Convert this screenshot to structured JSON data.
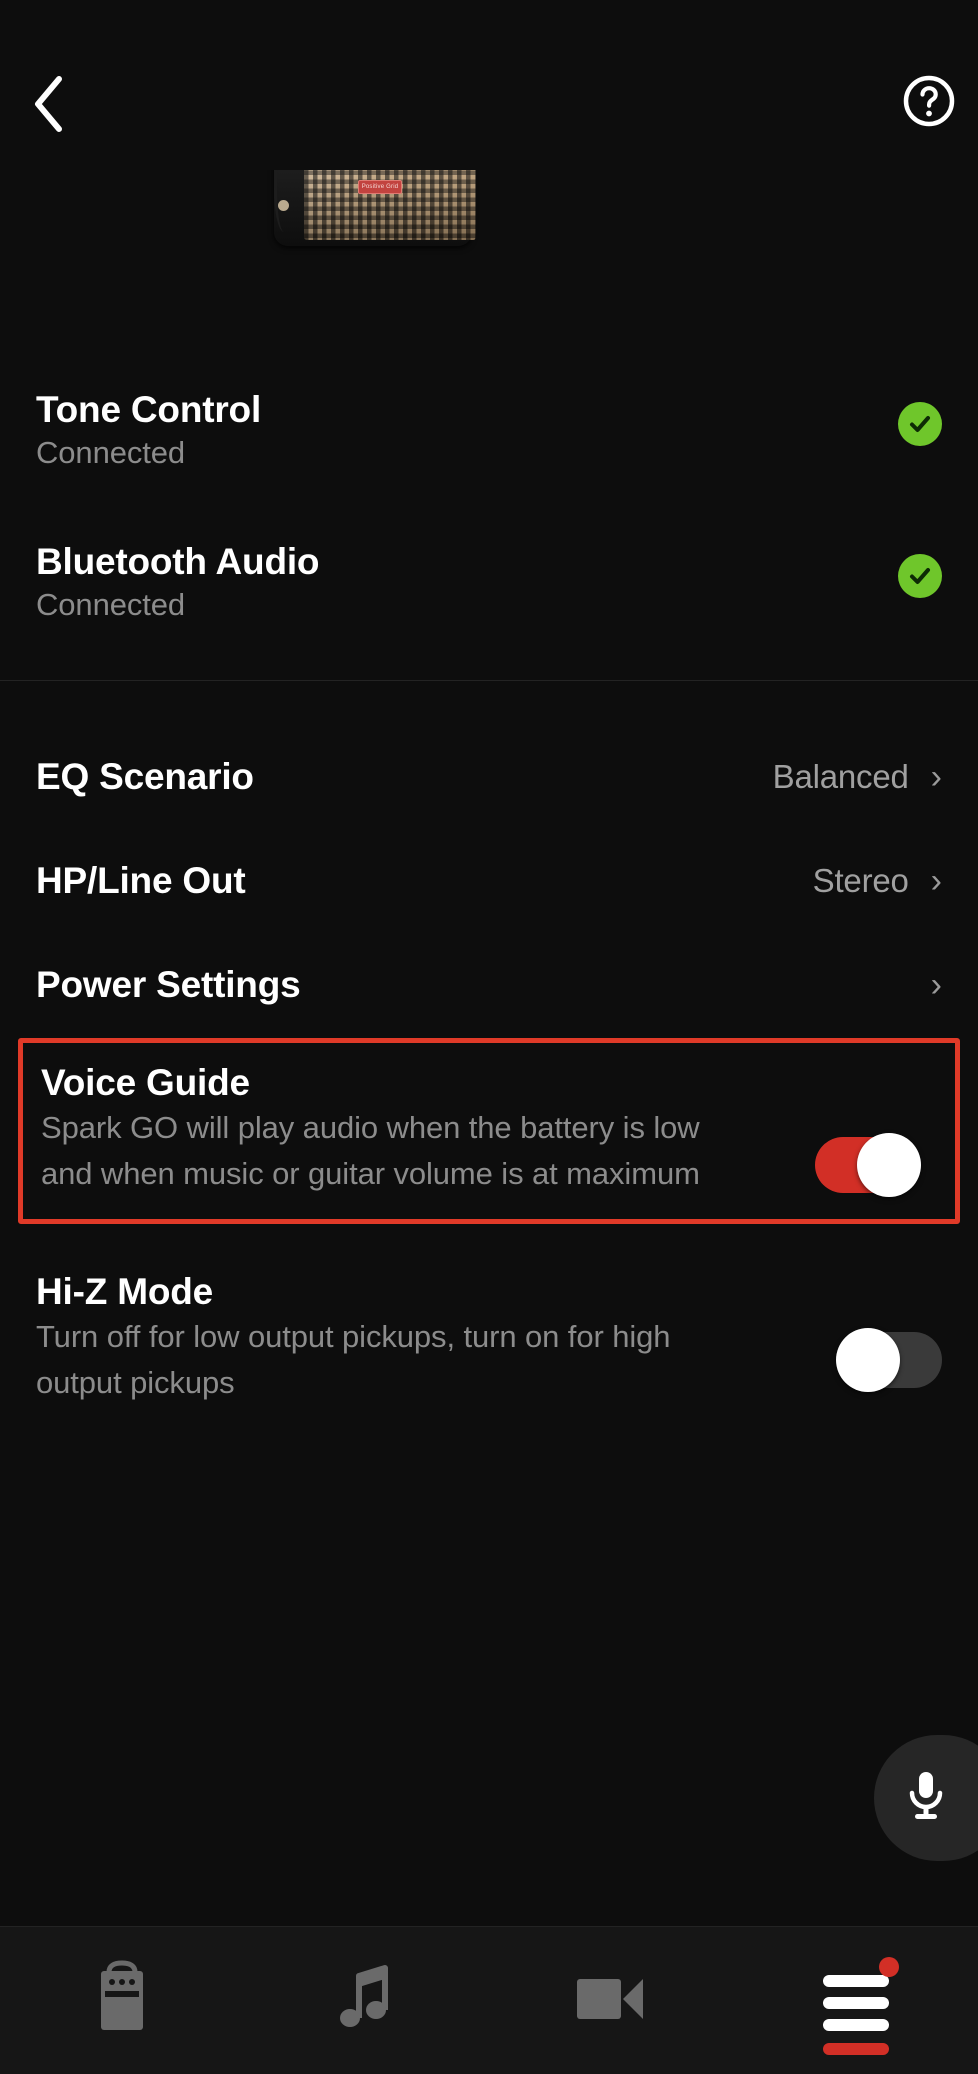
{
  "header": {
    "back_icon": "chevron-left-icon",
    "help_icon": "help-circle-icon"
  },
  "hero": {
    "device_image": "spark-go-amp",
    "brand_logo": "Positive Grid"
  },
  "status_items": [
    {
      "title": "Tone Control",
      "subtitle": "Connected",
      "status_icon": "check-circle-icon"
    },
    {
      "title": "Bluetooth Audio",
      "subtitle": "Connected",
      "status_icon": "check-circle-icon"
    }
  ],
  "nav_items": [
    {
      "title": "EQ Scenario",
      "value": "Balanced",
      "chevron": "›"
    },
    {
      "title": "HP/Line Out",
      "value": "Stereo",
      "chevron": "›"
    },
    {
      "title": "Power Settings",
      "value": "",
      "chevron": "›"
    }
  ],
  "voice_guide": {
    "title": "Voice Guide",
    "description": "Spark GO will play audio when the battery is low and when music or guitar volume is at maximum",
    "toggle_state": "on",
    "highlighted": true
  },
  "hiz_mode": {
    "title": "Hi-Z Mode",
    "description": "Turn off for low output pickups, turn on for high output pickups",
    "toggle_state": "off"
  },
  "mic_button": {
    "icon": "microphone-icon"
  },
  "bottom_nav": [
    {
      "icon": "amp-icon",
      "active": false,
      "badge": false
    },
    {
      "icon": "music-note-icon",
      "active": false,
      "badge": false
    },
    {
      "icon": "video-camera-icon",
      "active": false,
      "badge": false
    },
    {
      "icon": "menu-icon",
      "active": true,
      "badge": true
    }
  ],
  "colors": {
    "background": "#0d0d0d",
    "accent_red": "#d22f26",
    "highlight_red": "#e03a28",
    "status_green": "#6fc62b",
    "text_primary": "#ffffff",
    "text_secondary": "#8c8c8c"
  }
}
